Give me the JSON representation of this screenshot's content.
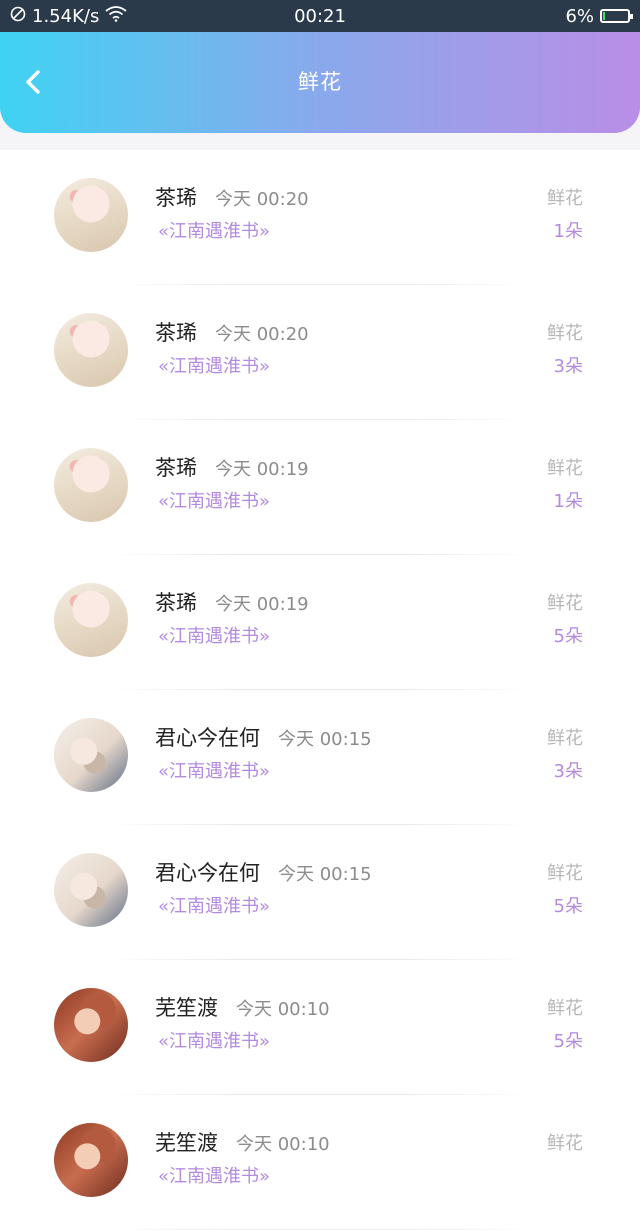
{
  "status_bar": {
    "network_speed": "1.54K/s",
    "time": "00:21",
    "battery": "6%",
    "battery_level": 0.06
  },
  "header": {
    "title": "鲜花",
    "back_icon": "chevron-left-icon",
    "gradient_start": "#3fd3f2",
    "gradient_end": "#b98ee6"
  },
  "records": [
    {
      "name": "茶琋",
      "time": "今天 00:20",
      "book": "«江南遇淮书»",
      "gift": "鲜花",
      "count": "1朵",
      "avatar": "a1"
    },
    {
      "name": "茶琋",
      "time": "今天 00:20",
      "book": "«江南遇淮书»",
      "gift": "鲜花",
      "count": "3朵",
      "avatar": "a1"
    },
    {
      "name": "茶琋",
      "time": "今天 00:19",
      "book": "«江南遇淮书»",
      "gift": "鲜花",
      "count": "1朵",
      "avatar": "a1"
    },
    {
      "name": "茶琋",
      "time": "今天 00:19",
      "book": "«江南遇淮书»",
      "gift": "鲜花",
      "count": "5朵",
      "avatar": "a1"
    },
    {
      "name": "君心今在何",
      "time": "今天 00:15",
      "book": "«江南遇淮书»",
      "gift": "鲜花",
      "count": "3朵",
      "avatar": "a2"
    },
    {
      "name": "君心今在何",
      "time": "今天 00:15",
      "book": "«江南遇淮书»",
      "gift": "鲜花",
      "count": "5朵",
      "avatar": "a2"
    },
    {
      "name": "芜笙渡",
      "time": "今天 00:10",
      "book": "«江南遇淮书»",
      "gift": "鲜花",
      "count": "5朵",
      "avatar": "a3"
    },
    {
      "name": "芜笙渡",
      "time": "今天 00:10",
      "book": "«江南遇淮书»",
      "gift": "鲜花",
      "count": "",
      "avatar": "a3"
    }
  ]
}
